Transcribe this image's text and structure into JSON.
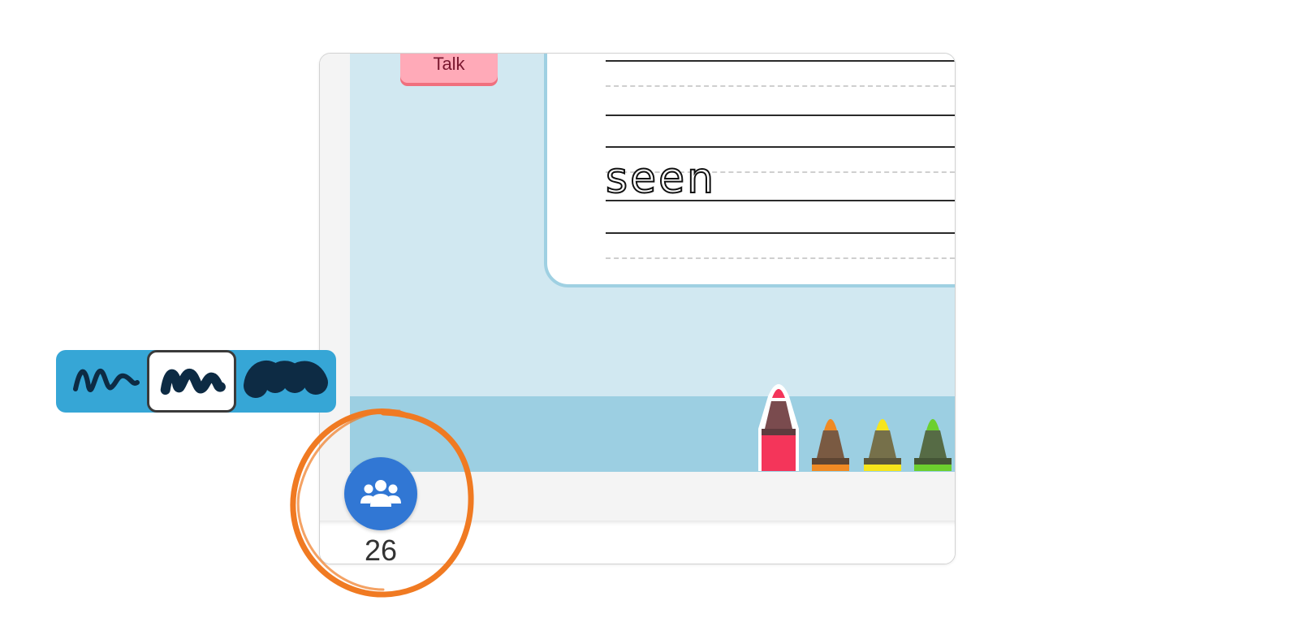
{
  "toolbar": {
    "talk_label": "Talk"
  },
  "worksheet": {
    "word": "seen"
  },
  "brushes": [
    {
      "name": "thin"
    },
    {
      "name": "medium",
      "selected": true
    },
    {
      "name": "thick"
    }
  ],
  "crayons": [
    {
      "color": "#f4355a",
      "icon": "red-crayon-icon",
      "selected": true
    },
    {
      "color": "#f08a24",
      "icon": "orange-crayon-icon"
    },
    {
      "color": "#f6e51c",
      "icon": "yellow-crayon-icon"
    },
    {
      "color": "#6ccf2e",
      "icon": "green-crayon-icon"
    }
  ],
  "students": {
    "count": "26",
    "icon": "group-icon"
  },
  "colors": {
    "board": "#d1e8f1",
    "brush_tray": "#36a6d6",
    "group_button": "#3177d4",
    "highlight": "#f07a22"
  }
}
